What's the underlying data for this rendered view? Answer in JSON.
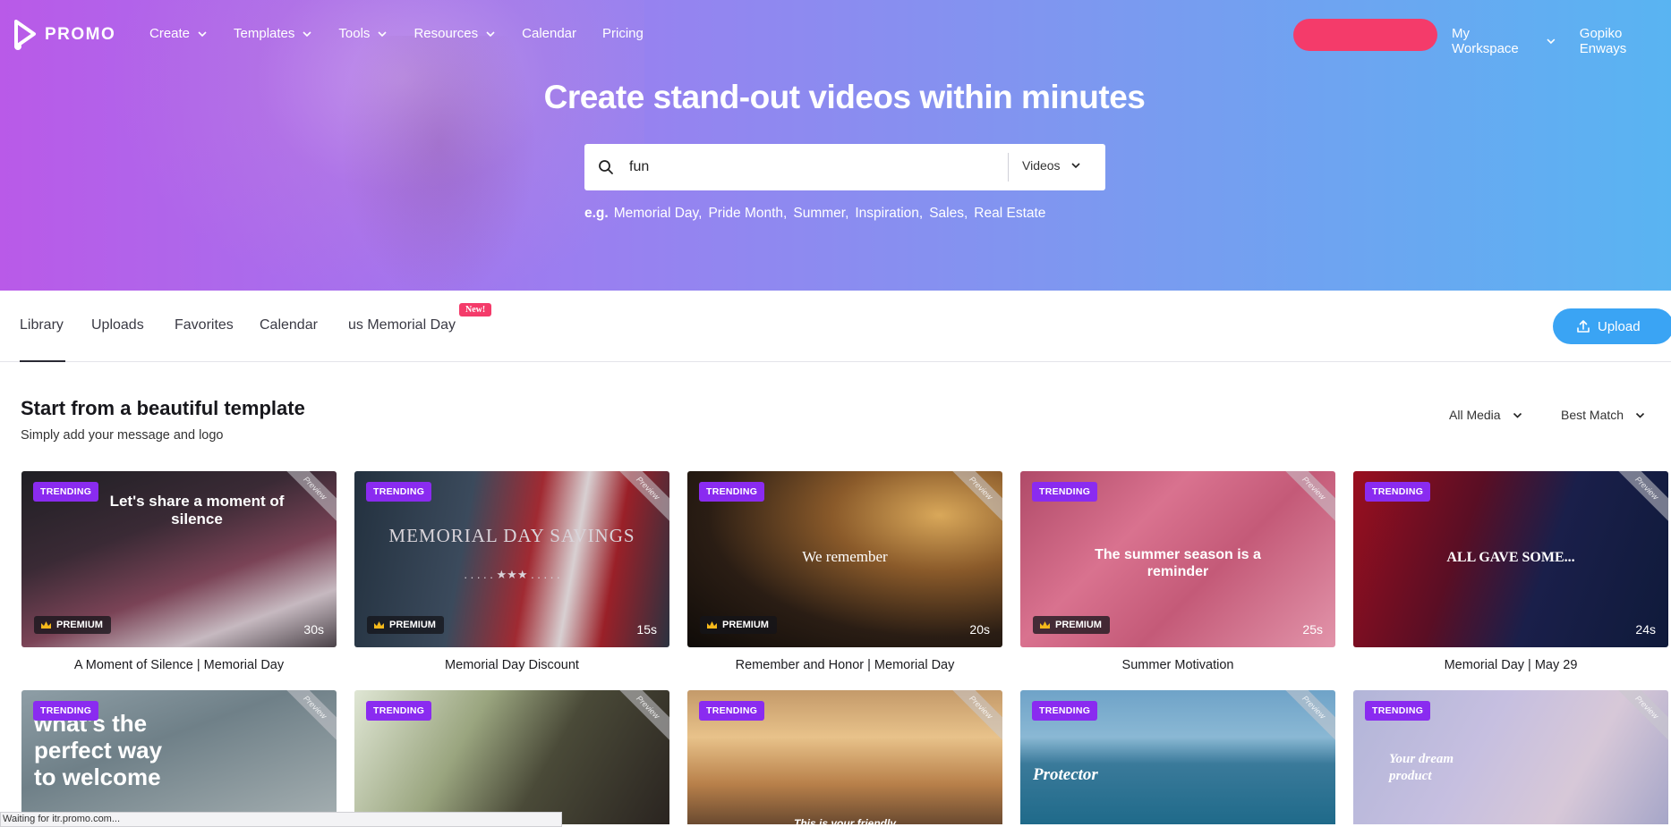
{
  "nav": {
    "logo_text": "PROMO",
    "items": [
      {
        "label": "Create",
        "dropdown": true
      },
      {
        "label": "Templates",
        "dropdown": true
      },
      {
        "label": "Tools",
        "dropdown": true
      },
      {
        "label": "Resources",
        "dropdown": true
      },
      {
        "label": "Calendar",
        "dropdown": false
      },
      {
        "label": "Pricing",
        "dropdown": false
      }
    ],
    "cta_label": "",
    "workspace_label": "My Workspace",
    "user_label": "Gopiko Enways",
    "cta_color": "#f43b6a"
  },
  "hero": {
    "title": "Create stand-out videos within minutes",
    "search": {
      "value": "fun",
      "placeholder": "",
      "type_selected": "Videos"
    },
    "examples_prefix": "e.g.",
    "examples": [
      "Memorial Day,",
      "Pride Month,",
      "Summer,",
      "Inspiration,",
      "Sales,",
      "Real Estate"
    ]
  },
  "tabs": {
    "items": [
      "Library",
      "Uploads",
      "Favorites",
      "Calendar",
      "us Memorial Day"
    ],
    "active": "Library",
    "new_badge": "New!",
    "upload_label": "Upload"
  },
  "section": {
    "title": "Start from a beautiful template",
    "subtitle": "Simply add your message and logo",
    "filter_media": "All Media",
    "filter_sort": "Best Match"
  },
  "labels": {
    "trending": "TRENDING",
    "premium": "PREMIUM",
    "preview": "Preview"
  },
  "cards": [
    {
      "title": "A Moment of Silence | Memorial Day",
      "overlay": "Let's share a moment of silence",
      "duration": "30s",
      "premium": true
    },
    {
      "title": "Memorial Day Discount",
      "overlay": "MEMORIAL DAY SAVINGS",
      "overlay2": ". . . . .  ★★★  . . . . .",
      "duration": "15s",
      "premium": true
    },
    {
      "title": "Remember and Honor | Memorial Day",
      "overlay": "We remember",
      "duration": "20s",
      "premium": true
    },
    {
      "title": "Summer Motivation",
      "overlay": "The summer season is a reminder",
      "duration": "25s",
      "premium": true
    },
    {
      "title": "Memorial Day | May 29",
      "overlay": "ALL GAVE SOME...",
      "duration": "24s",
      "premium": false
    }
  ],
  "cards_row2": [
    {
      "overlay": "what's the perfect way to welcome"
    },
    {
      "overlay": ""
    },
    {
      "overlay": "This is your friendly"
    },
    {
      "overlay": "Protector"
    },
    {
      "overlay": "Your dream product"
    }
  ],
  "status": "Waiting for itr.promo.com..."
}
